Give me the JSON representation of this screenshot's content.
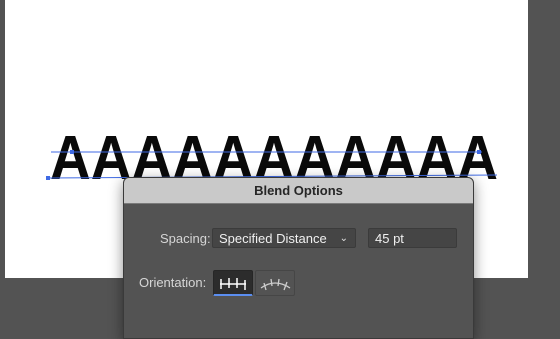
{
  "artboard": {
    "blend_text": "AAAAAAAAAAA",
    "path_color": "#3f6ae4"
  },
  "dialog": {
    "title": "Blend Options",
    "spacing": {
      "label": "Spacing:",
      "selected": "Specified Distance",
      "value": "45 pt"
    },
    "orientation": {
      "label": "Orientation:",
      "options": [
        "align-to-page-icon",
        "align-to-path-icon"
      ],
      "selected": "align-to-page-icon"
    }
  },
  "colors": {
    "accent": "#5b8ef0",
    "dialog_bg": "#535353",
    "titlebar_bg": "#c9c9c9"
  }
}
